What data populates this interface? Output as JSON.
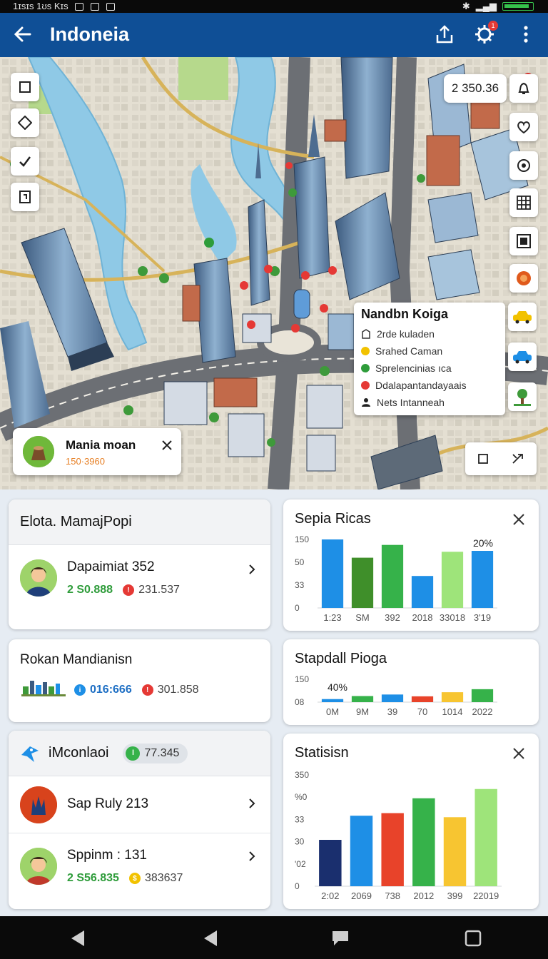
{
  "status_bar": {
    "left_text": "1ɪsɪs 1ʊs Kɪs"
  },
  "app_bar": {
    "title": "Indoneia",
    "settings_badge": "1"
  },
  "map": {
    "coord_readout": "2 350.36",
    "poi_card": {
      "title": "Nandbn Koiga",
      "items": [
        {
          "label": "2rde kuladen",
          "icon": "building-icon",
          "color": "#333333"
        },
        {
          "label": "Srahed Caman",
          "icon": "sun-icon",
          "color": "#f2c200"
        },
        {
          "label": "Sprelencinias ıca",
          "icon": "leaf-icon",
          "color": "#2e9c3a"
        },
        {
          "label": "Ddalapantandayaais",
          "icon": "pin-icon",
          "color": "#e53935"
        },
        {
          "label": "Nets Intanneah",
          "icon": "person-icon",
          "color": "#222222"
        }
      ]
    },
    "location_card": {
      "name": "Mania moan",
      "value": "150·3960"
    }
  },
  "panels": {
    "elota": {
      "title": "Elota. MamajPopi",
      "row": {
        "name": "Dapaimiat 352",
        "v1": "2 S0.888",
        "v2": "231.537"
      }
    },
    "rokan": {
      "name": "Rokan Mandianisn",
      "v1": "016:666",
      "v2": "301.858"
    },
    "imconlaoi": {
      "title": "iMconlaoi",
      "pill": "77.345",
      "rows": [
        {
          "name": "Sap Ruly 213"
        },
        {
          "name": "Sppinm : 131",
          "v1": "2 S56.835",
          "v2": "383637"
        }
      ]
    }
  },
  "chart_data": [
    {
      "type": "bar",
      "title": "Sepia Ricas",
      "yticks": [
        "150",
        "50",
        "33",
        "0"
      ],
      "categories": [
        "1:23",
        "SM",
        "392",
        "2018",
        "33018",
        "3'19"
      ],
      "values": [
        150,
        110,
        138,
        70,
        123,
        125
      ],
      "colors": [
        "#1e8fe6",
        "#3f8f2a",
        "#36b24a",
        "#1e8fe6",
        "#9ee47a",
        "#1e8fe6"
      ],
      "annotation": "20%",
      "ylim": [
        0,
        150
      ]
    },
    {
      "type": "bar",
      "title": "Stapdall Pioga",
      "yticks": [
        "150",
        "08"
      ],
      "categories": [
        "0M",
        "9M",
        "39",
        "70",
        "1014",
        "2022"
      ],
      "values": [
        20,
        40,
        50,
        38,
        65,
        85
      ],
      "colors": [
        "#1e8fe6",
        "#36b24a",
        "#1e8fe6",
        "#e8432a",
        "#f7c531",
        "#36b24a"
      ],
      "annotation": "40%",
      "ylim": [
        0,
        150
      ]
    },
    {
      "type": "bar",
      "title": "Statisisn",
      "yticks": [
        "350",
        "%0",
        "33",
        "30",
        "'02",
        "0"
      ],
      "categories": [
        "2:02",
        "2069",
        "738",
        "2012",
        "399",
        "22019"
      ],
      "values": [
        125,
        190,
        197,
        237,
        186,
        262
      ],
      "colors": [
        "#1a2f6e",
        "#1e8fe6",
        "#e8432a",
        "#36b24a",
        "#f7c531",
        "#9ee47a"
      ],
      "annotation": "",
      "ylim": [
        0,
        300
      ]
    }
  ]
}
